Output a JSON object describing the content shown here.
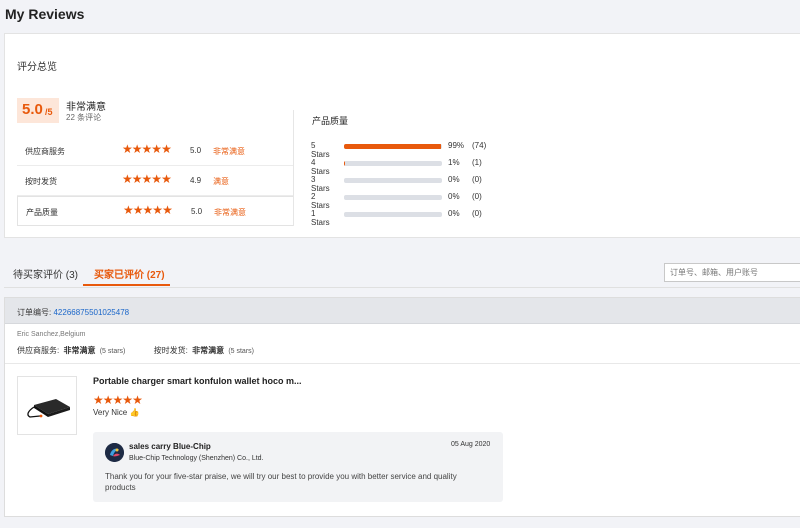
{
  "page": {
    "title": "My Reviews"
  },
  "summary": {
    "title": "评分总览",
    "score_main": "5.0",
    "score_denom": "/5",
    "overall_label": "非常满意",
    "review_count": "22 条评论",
    "categories": [
      {
        "name": "供应商服务",
        "rating": 5,
        "score": "5.0",
        "level": "非常满意"
      },
      {
        "name": "按时发货",
        "rating": 5,
        "score": "4.9",
        "level": "满意"
      },
      {
        "name": "产品质量",
        "rating": 5,
        "score": "5.0",
        "level": "非常满意"
      }
    ],
    "quality_title": "产品质量",
    "distribution": [
      {
        "label": "5 Stars",
        "fraction": 0.99,
        "percent": "99%",
        "count": "(74)"
      },
      {
        "label": "4 Stars",
        "fraction": 0.01,
        "percent": "1%",
        "count": "(1)"
      },
      {
        "label": "3 Stars",
        "fraction": 0,
        "percent": "0%",
        "count": "(0)"
      },
      {
        "label": "2 Stars",
        "fraction": 0,
        "percent": "0%",
        "count": "(0)"
      },
      {
        "label": "1 Stars",
        "fraction": 0,
        "percent": "0%",
        "count": "(0)"
      }
    ]
  },
  "tabs": [
    {
      "label": "待买家评价 (3)",
      "active": false
    },
    {
      "label": "买家已评价 (27)",
      "active": true
    }
  ],
  "search": {
    "placeholder": "订单号、邮箱、用户账号"
  },
  "order": {
    "number_label": "订单编号:",
    "number": "42266875501025478",
    "buyer": "Eric Sanchez,Belgium",
    "seller_service_label": "供应商服务:",
    "seller_service_value": "非常满意",
    "seller_service_stars": "(5 stars)",
    "shipping_label": "按时发货:",
    "shipping_value": "非常满意",
    "shipping_stars": "(5 stars)",
    "product_title": "Portable charger smart konfulon wallet hoco m...",
    "product_rating": 5,
    "review_text": "Very Nice",
    "reply": {
      "name": "sales carry Blue-Chip",
      "company": "Blue-Chip Technology (Shenzhen) Co., Ltd.",
      "date": "05 Aug 2020",
      "message": "Thank you for your five-star praise, we will try our best to provide you with better service and quality products"
    }
  },
  "colors": {
    "accent": "#e8590c",
    "link": "#1a66c9",
    "bar_bg": "#dcdfe5"
  }
}
